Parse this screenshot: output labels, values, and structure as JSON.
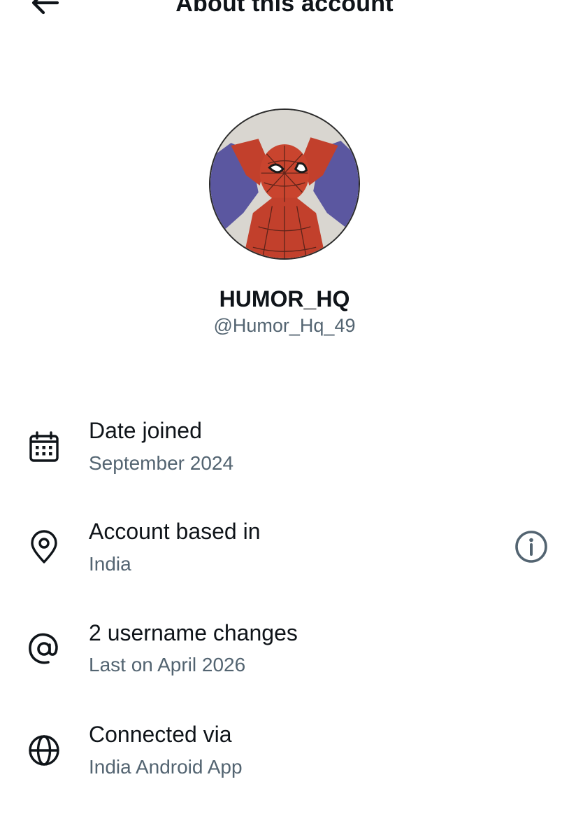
{
  "header": {
    "title": "About this account",
    "back_icon": "arrow-left-icon"
  },
  "profile": {
    "display_name": "HUMOR_HQ",
    "handle": "@Humor_Hq_49",
    "avatar_description_icon": "avatar-image"
  },
  "rows": [
    {
      "icon": "calendar-icon",
      "label": "Date joined",
      "value": "September 2024"
    },
    {
      "icon": "location-pin-icon",
      "label": "Account based in",
      "value": "India",
      "trailing_icon": "info-icon"
    },
    {
      "icon": "at-sign-icon",
      "label": "2 username changes",
      "value": "Last on April 2026"
    },
    {
      "icon": "globe-icon",
      "label": "Connected via",
      "value": "India Android App"
    }
  ],
  "colors": {
    "primary_text": "#0f1419",
    "secondary_text": "#536471",
    "background": "#ffffff"
  }
}
